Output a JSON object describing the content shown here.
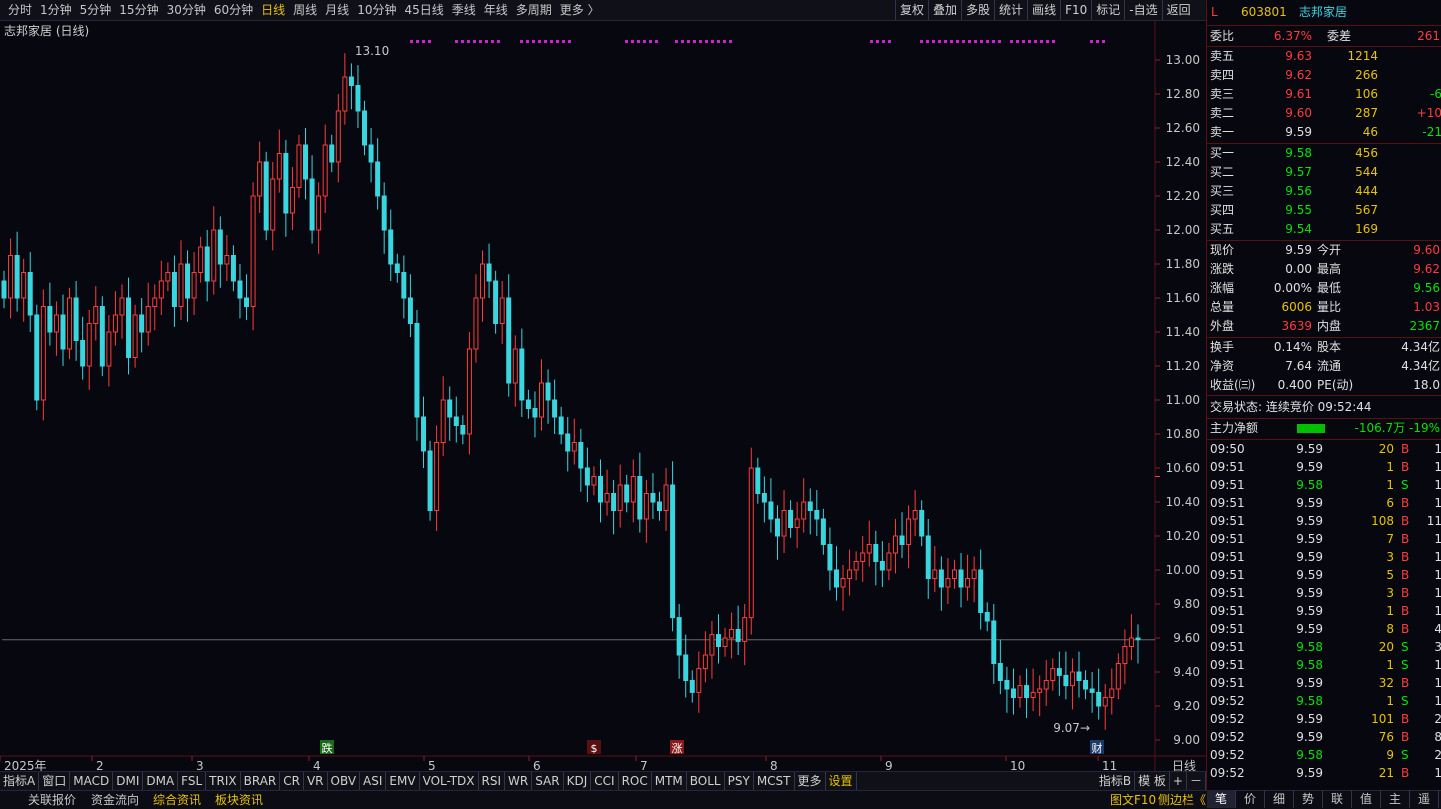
{
  "toolbar": {
    "periods": [
      "分时",
      "1分钟",
      "5分钟",
      "15分钟",
      "30分钟",
      "60分钟",
      "日线",
      "周线",
      "月线",
      "10分钟",
      "45日线",
      "季线",
      "年线",
      "多周期",
      "更多 〉"
    ],
    "active_period": "日线",
    "tools": [
      "复权",
      "叠加",
      "多股",
      "统计",
      "画线",
      "F10",
      "标记",
      "-自选",
      "返回"
    ]
  },
  "chart_title": "志邦家居 (日线)",
  "chart_data": {
    "type": "candlestick",
    "y_ticks": [
      "13.00",
      "12.80",
      "12.60",
      "12.40",
      "12.20",
      "12.00",
      "11.80",
      "11.60",
      "11.40",
      "11.20",
      "11.00",
      "10.80",
      "10.60",
      "10.40",
      "10.20",
      "10.00",
      "9.80",
      "9.60",
      "9.40",
      "9.20",
      "9.00"
    ],
    "ylim": [
      9.0,
      13.1
    ],
    "x_ticks": [
      "2025年",
      "2",
      "3",
      "4",
      "5",
      "6",
      "7",
      "8",
      "9",
      "10",
      "11"
    ],
    "x_label_right": "日线",
    "high_label": "13.10",
    "low_label": "9.07",
    "current_price": 9.59,
    "markers": [
      "跌",
      "$",
      "涨",
      "财"
    ],
    "closes": [
      11.6,
      11.85,
      11.6,
      11.75,
      11.5,
      11.0,
      11.55,
      11.4,
      11.5,
      11.3,
      11.6,
      11.35,
      11.2,
      11.45,
      11.55,
      11.2,
      11.4,
      11.5,
      11.6,
      11.25,
      11.5,
      11.4,
      11.55,
      11.6,
      11.7,
      11.75,
      11.55,
      11.8,
      11.6,
      11.75,
      11.9,
      11.7,
      12.0,
      11.8,
      11.85,
      11.7,
      11.6,
      11.55,
      12.2,
      12.4,
      12.0,
      12.3,
      12.45,
      12.1,
      12.25,
      12.5,
      12.3,
      12.0,
      12.2,
      12.5,
      12.4,
      12.7,
      12.9,
      12.85,
      12.7,
      12.5,
      12.4,
      12.2,
      12.0,
      11.8,
      11.75,
      11.6,
      11.45,
      10.9,
      10.7,
      10.35,
      10.75,
      11.0,
      10.9,
      10.85,
      10.8,
      11.3,
      11.6,
      11.8,
      11.7,
      11.45,
      11.6,
      11.1,
      11.3,
      11.0,
      10.95,
      10.9,
      11.1,
      11.0,
      10.9,
      10.8,
      10.7,
      10.75,
      10.6,
      10.5,
      10.55,
      10.4,
      10.45,
      10.35,
      10.5,
      10.4,
      10.55,
      10.3,
      10.45,
      10.4,
      10.35,
      10.5,
      9.72,
      9.5,
      9.35,
      9.28,
      9.42,
      9.5,
      9.62,
      9.55,
      9.6,
      9.65,
      9.58,
      9.72,
      10.6,
      10.45,
      10.4,
      10.3,
      10.2,
      10.35,
      10.25,
      10.3,
      10.4,
      10.35,
      10.3,
      10.15,
      10.0,
      9.9,
      9.95,
      10.0,
      10.05,
      10.1,
      10.15,
      10.05,
      10.0,
      10.1,
      10.2,
      10.15,
      10.3,
      10.35,
      10.2,
      9.95,
      10.0,
      9.9,
      9.95,
      10.0,
      9.9,
      9.95,
      10.0,
      9.75,
      9.7,
      9.45,
      9.35,
      9.3,
      9.25,
      9.32,
      9.25,
      9.28,
      9.3,
      9.35,
      9.42,
      9.38,
      9.32,
      9.4,
      9.35,
      9.3,
      9.28,
      9.2,
      9.25,
      9.3,
      9.45,
      9.55,
      9.6,
      9.59
    ],
    "annotations": [
      "13.10",
      "9.07"
    ]
  },
  "indicator_tabs": [
    "指标A",
    "窗口",
    "MACD",
    "DMI",
    "DMA",
    "FSL",
    "TRIX",
    "BRAR",
    "CR",
    "VR",
    "OBV",
    "ASI",
    "EMV",
    "VOL-TDX",
    "RSI",
    "WR",
    "SAR",
    "KDJ",
    "CCI",
    "ROC",
    "MTM",
    "BOLL",
    "PSY",
    "MCST",
    "更多",
    "设置"
  ],
  "indicator_right": [
    "指标B",
    "模 板",
    "+",
    "－"
  ],
  "status": [
    "关联报价",
    "资金流向",
    "综合资讯",
    "板块资讯",
    "图文F10",
    "侧边栏《"
  ],
  "panel": {
    "flag": "L",
    "code": "603801",
    "name": "志邦家居",
    "weibi_label": "委比",
    "weibi": "6.37%",
    "weicha_label": "委差",
    "weicha": "261",
    "asks": [
      {
        "label": "卖五",
        "price": "9.63",
        "vol": "1214",
        "chg": ""
      },
      {
        "label": "卖四",
        "price": "9.62",
        "vol": "266",
        "chg": ""
      },
      {
        "label": "卖三",
        "price": "9.61",
        "vol": "106",
        "chg": "-6"
      },
      {
        "label": "卖二",
        "price": "9.60",
        "vol": "287",
        "chg": "+10"
      },
      {
        "label": "卖一",
        "price": "9.59",
        "vol": "46",
        "chg": "-21"
      }
    ],
    "bids": [
      {
        "label": "买一",
        "price": "9.58",
        "vol": "456"
      },
      {
        "label": "买二",
        "price": "9.57",
        "vol": "544"
      },
      {
        "label": "买三",
        "price": "9.56",
        "vol": "444"
      },
      {
        "label": "买四",
        "price": "9.55",
        "vol": "567"
      },
      {
        "label": "买五",
        "price": "9.54",
        "vol": "169"
      }
    ],
    "quote": [
      {
        "l1": "现价",
        "v1": "9.59",
        "l2": "今开",
        "v2": "9.60"
      },
      {
        "l1": "涨跌",
        "v1": "0.00",
        "l2": "最高",
        "v2": "9.62"
      },
      {
        "l1": "涨幅",
        "v1": "0.00%",
        "l2": "最低",
        "v2": "9.56"
      },
      {
        "l1": "总量",
        "v1": "6006",
        "l2": "量比",
        "v2": "1.03"
      },
      {
        "l1": "外盘",
        "v1": "3639",
        "l2": "内盘",
        "v2": "2367"
      }
    ],
    "stats": [
      {
        "l1": "换手",
        "v1": "0.14%",
        "l2": "股本",
        "v2": "4.34亿"
      },
      {
        "l1": "净资",
        "v1": "7.64",
        "l2": "流通",
        "v2": "4.34亿"
      },
      {
        "l1": "收益(㈢)",
        "v1": "0.400",
        "l2": "PE(动)",
        "v2": "18.0"
      }
    ],
    "trade_status": "交易状态: 连续竞价 09:52:44",
    "main_flow_label": "主力净额",
    "main_flow": "-106.7万 -19%",
    "ticks": [
      {
        "t": "09:50",
        "p": "9.59",
        "v": "20",
        "s": "B",
        "n": "1"
      },
      {
        "t": "09:51",
        "p": "9.59",
        "v": "1",
        "s": "B",
        "n": "1"
      },
      {
        "t": "09:51",
        "p": "9.58",
        "v": "1",
        "s": "S",
        "n": "1"
      },
      {
        "t": "09:51",
        "p": "9.59",
        "v": "6",
        "s": "B",
        "n": "1"
      },
      {
        "t": "09:51",
        "p": "9.59",
        "v": "108",
        "s": "B",
        "n": "11"
      },
      {
        "t": "09:51",
        "p": "9.59",
        "v": "7",
        "s": "B",
        "n": "1"
      },
      {
        "t": "09:51",
        "p": "9.59",
        "v": "3",
        "s": "B",
        "n": "1"
      },
      {
        "t": "09:51",
        "p": "9.59",
        "v": "5",
        "s": "B",
        "n": "1"
      },
      {
        "t": "09:51",
        "p": "9.59",
        "v": "3",
        "s": "B",
        "n": "1"
      },
      {
        "t": "09:51",
        "p": "9.59",
        "v": "1",
        "s": "B",
        "n": "1"
      },
      {
        "t": "09:51",
        "p": "9.59",
        "v": "8",
        "s": "B",
        "n": "4"
      },
      {
        "t": "09:51",
        "p": "9.58",
        "v": "20",
        "s": "S",
        "n": "3"
      },
      {
        "t": "09:51",
        "p": "9.58",
        "v": "1",
        "s": "S",
        "n": "1"
      },
      {
        "t": "09:51",
        "p": "9.59",
        "v": "32",
        "s": "B",
        "n": "1"
      },
      {
        "t": "09:52",
        "p": "9.58",
        "v": "1",
        "s": "S",
        "n": "1"
      },
      {
        "t": "09:52",
        "p": "9.59",
        "v": "101",
        "s": "B",
        "n": "2"
      },
      {
        "t": "09:52",
        "p": "9.59",
        "v": "76",
        "s": "B",
        "n": "8"
      },
      {
        "t": "09:52",
        "p": "9.58",
        "v": "9",
        "s": "S",
        "n": "2"
      },
      {
        "t": "09:52",
        "p": "9.59",
        "v": "21",
        "s": "B",
        "n": "1"
      }
    ],
    "tabs": [
      "笔",
      "价",
      "细",
      "势",
      "联",
      "值",
      "主",
      "遥"
    ]
  },
  "colors": {
    "up": "#ff3b3b",
    "down": "#3ad6e0",
    "bg": "#07070f",
    "accent": "#e8c300"
  }
}
